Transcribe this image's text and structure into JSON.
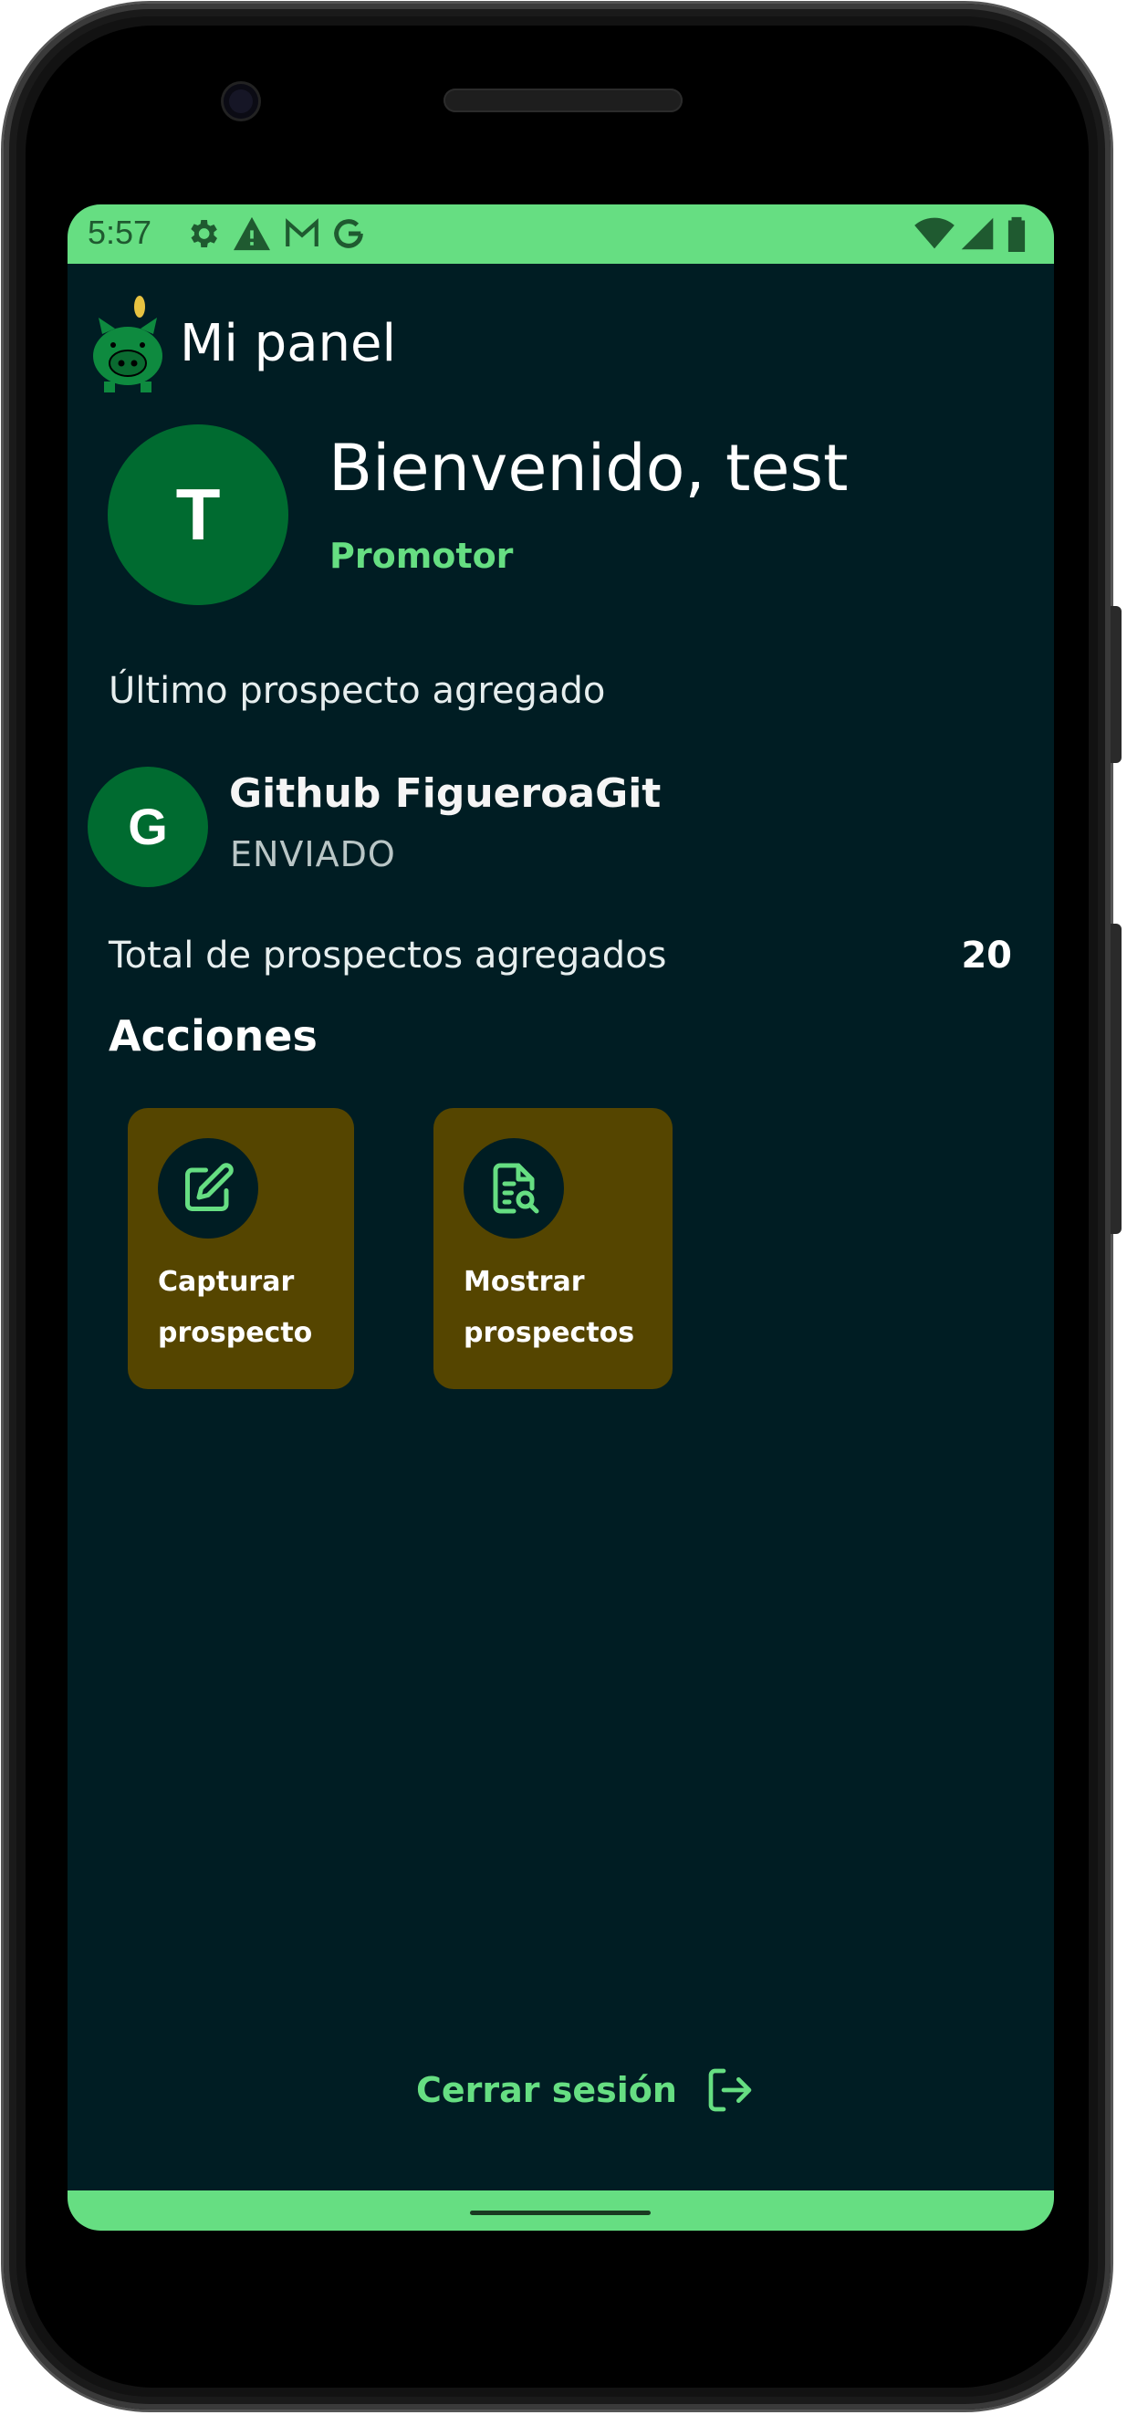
{
  "status_bar": {
    "time": "5:57",
    "icons": [
      "settings-icon",
      "warning-icon",
      "gmail-icon",
      "google-icon",
      "wifi-icon",
      "signal-icon",
      "battery-icon"
    ]
  },
  "header": {
    "title": "Mi panel",
    "logo_icon": "piggy-bank-icon"
  },
  "profile": {
    "avatar_letter": "T",
    "welcome": "Bienvenido, test",
    "role": "Promotor"
  },
  "last_prospect": {
    "section_label": "Último prospecto agregado",
    "avatar_letter": "G",
    "name": "Github FigueroaGit",
    "status": "ENVIADO"
  },
  "totals": {
    "label": "Total de prospectos agregados",
    "value": "20"
  },
  "actions": {
    "title": "Acciones",
    "items": [
      {
        "label_line1": "Capturar",
        "label_line2": "prospecto",
        "icon": "edit-icon"
      },
      {
        "label_line1": "Mostrar",
        "label_line2": "prospectos",
        "icon": "document-search-icon"
      }
    ]
  },
  "logout": {
    "label": "Cerrar sesión",
    "icon": "logout-icon"
  },
  "colors": {
    "background": "#001d23",
    "accent_green": "#66de82",
    "avatar_green": "#006b30",
    "action_card": "#554500"
  }
}
